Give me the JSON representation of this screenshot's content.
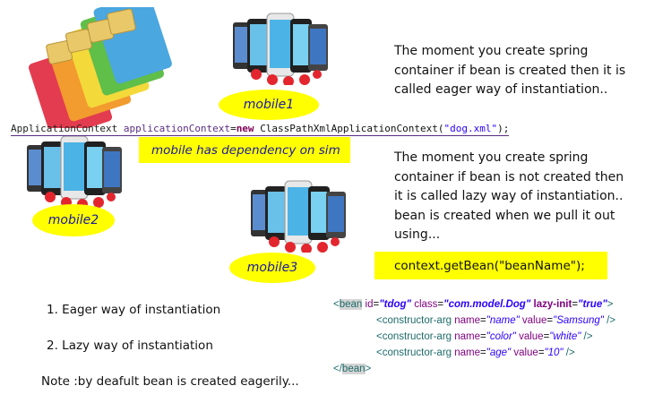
{
  "sim_image": {
    "icon": "sim-cards-icon"
  },
  "phones": {
    "icon": "smartphones-icon"
  },
  "labels": {
    "mobile1": "mobile1",
    "mobile2": "mobile2",
    "mobile3": "mobile3",
    "dependency": "mobile has dependency on sim"
  },
  "eager_text": {
    "line1": "The moment you create spring",
    "line2": "container if bean is created then it is",
    "line3": "called eager way of instantiation.."
  },
  "lazy_text": {
    "line1": "The moment you create spring",
    "line2": "container if bean is not created then",
    "line3": "it is called lazy way of instantiation..",
    "line4": "bean is created when we pull it out",
    "line5": "using..."
  },
  "code_line": {
    "type1": "ApplicationContext",
    "var": "applicationContext",
    "eq": "=",
    "kw_new": "new",
    "type2": "ClassPathXmlApplicationContext(",
    "str": "\"dog.xml\"",
    "end": ");"
  },
  "getbean": "context.getBean(\"beanName\");",
  "list": {
    "item1": "1. Eager way of instantiation",
    "item2": "2. Lazy way of instantiation",
    "note": "Note :by deafult bean is created eagerily..."
  },
  "xml": {
    "bean_open": "<",
    "bean_tag": "bean",
    "id_attr": "id",
    "id_val": "\"tdog\"",
    "class_attr": "class",
    "class_val": "\"com.model.Dog\"",
    "lazy_attr": "lazy-init",
    "lazy_val": "\"true\"",
    "bean_close_bracket": ">",
    "ctor_tag": "<constructor-arg",
    "name_attr": "name",
    "value_attr": "value",
    "args": [
      {
        "name": "\"name\"",
        "value": "\"Samsung\""
      },
      {
        "name": "\"color\"",
        "value": "\"white\""
      },
      {
        "name": "\"age\"",
        "value": "\"10\""
      }
    ],
    "self_close": "/>",
    "bean_end_open": "</",
    "bean_end_tag": "bean",
    "bean_end_close": ">"
  }
}
